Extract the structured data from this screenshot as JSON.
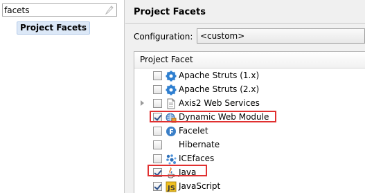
{
  "filter": {
    "value": "facets"
  },
  "nav": {
    "selected_label": "Project Facets"
  },
  "page": {
    "title": "Project Facets"
  },
  "configuration": {
    "label": "Configuration:",
    "value": "<custom>"
  },
  "table": {
    "header": "Project Facet",
    "rows": [
      {
        "label": "Apache Struts (1.x)",
        "checked": false,
        "icon": "struts-gear-icon"
      },
      {
        "label": "Apache Struts (2.x)",
        "checked": false,
        "icon": "struts-gear-icon"
      },
      {
        "label": "Axis2 Web Services",
        "checked": false,
        "icon": "document-icon",
        "expandable": true
      },
      {
        "label": "Dynamic Web Module",
        "checked": true,
        "icon": "web-module-icon",
        "highlighted": true
      },
      {
        "label": "Facelet",
        "checked": false,
        "icon": "facelet-icon"
      },
      {
        "label": "Hibernate",
        "checked": false,
        "icon": "hibernate-icon"
      },
      {
        "label": "ICEfaces",
        "checked": false,
        "icon": "icefaces-icon"
      },
      {
        "label": "Java",
        "checked": true,
        "icon": "java-icon",
        "highlighted": true
      },
      {
        "label": "JavaScript",
        "checked": true,
        "icon": "javascript-icon"
      }
    ]
  },
  "colors": {
    "highlight": "#e03030",
    "selection": "#dce8f7"
  }
}
